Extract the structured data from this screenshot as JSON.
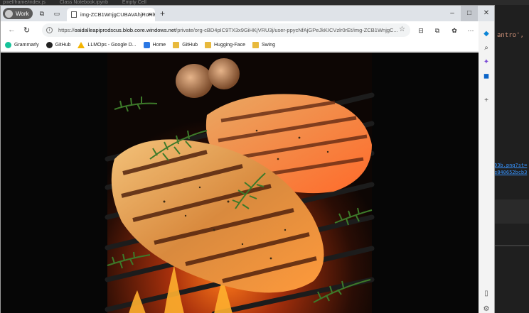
{
  "background": {
    "top_texts": [
      "pixel/frame/index.js",
      "Class Notebook.ipynb",
      "Empty Cell"
    ],
    "right_code": "antro',  'Lime",
    "right_links": [
      "03b.png?st=",
      "e840652bcb3"
    ]
  },
  "browser": {
    "profile_label": "Work",
    "tab_title": "img-ZCB1WnjgCUBAVAhjRoHlH",
    "tab_close": "×",
    "new_tab": "+",
    "window_controls": {
      "minimize": "–",
      "maximize": "□",
      "close": "✕"
    },
    "url_host": "oaidalleapiprodscus.blob.core.windows.net",
    "url_path": "/private/org-cBD4pIC9TX3x9GiHKjVRU3j/user-ppycNfAjGPeJkKICVzlr0rEt/img-ZCB1WnjgC...",
    "url_prefix": "https://",
    "bookmarks": [
      {
        "label": "Grammarly",
        "icon": "grammarly-icon"
      },
      {
        "label": "GitHub",
        "icon": "github-icon"
      },
      {
        "label": "LLMOps - Google D...",
        "icon": "google-drive-icon"
      },
      {
        "label": "Home",
        "icon": "home-icon"
      },
      {
        "label": "GitHub",
        "icon": "folder-icon"
      },
      {
        "label": "Hugging-Face",
        "icon": "folder-icon"
      },
      {
        "label": "Swing",
        "icon": "folder-icon"
      }
    ],
    "image_description_hidden": ""
  },
  "colors": {
    "accent": "#0067c0",
    "titlebar": "#dfe3e8"
  }
}
